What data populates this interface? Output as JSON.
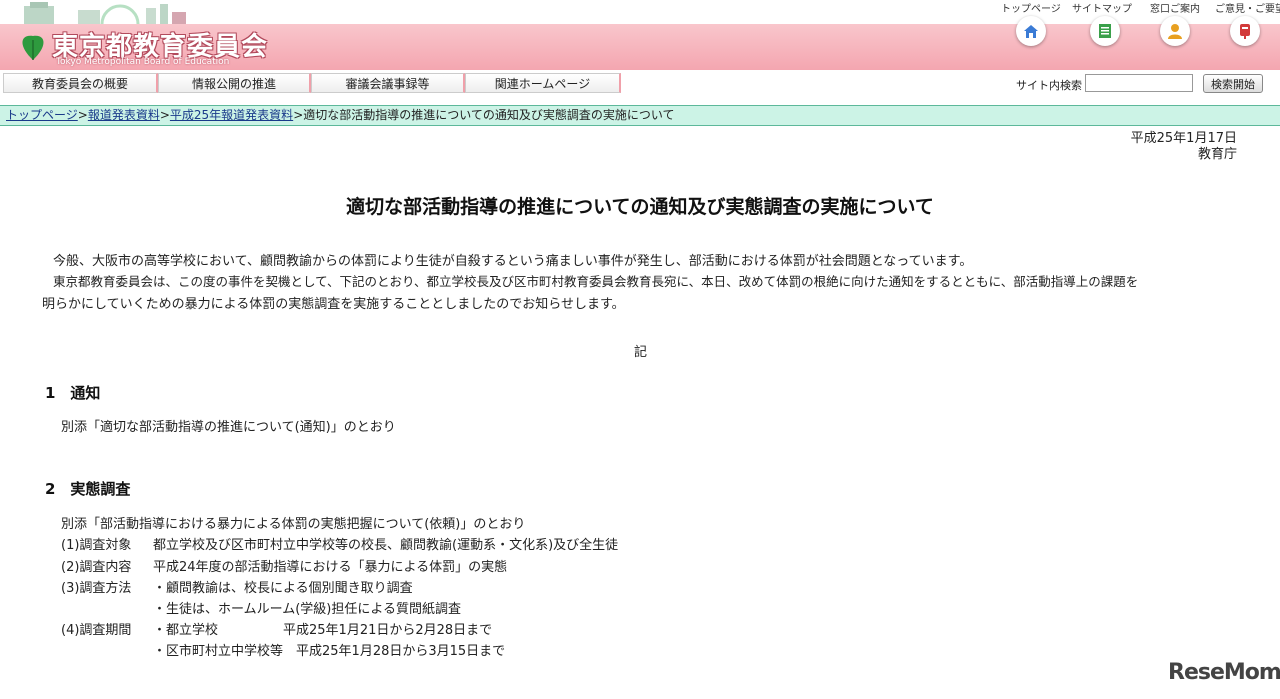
{
  "header": {
    "title": "東京都教育委員会",
    "subtitle": "Tokyo Metropolitan Board of Education",
    "utility_links": [
      {
        "label": "トップページ",
        "icon": "home-icon"
      },
      {
        "label": "サイトマップ",
        "icon": "sitemap-icon"
      },
      {
        "label": "窓口ご案内",
        "icon": "contact-person-icon"
      },
      {
        "label": "ご意見・ご要望",
        "icon": "mailbox-icon"
      }
    ],
    "brand_color": "#f4a6b0"
  },
  "nav": {
    "items": [
      "教育委員会の概要",
      "情報公開の推進",
      "審議会議事録等",
      "関連ホームページ"
    ]
  },
  "search": {
    "label": "サイト内検索",
    "value": "",
    "placeholder": "",
    "button_label": "検索開始"
  },
  "breadcrumb": {
    "links": [
      "トップページ",
      "報道発表資料",
      "平成25年報道発表資料"
    ],
    "separator": ">",
    "current": "適切な部活動指導の推進についての通知及び実態調査の実施について"
  },
  "document": {
    "date": "平成25年1月17日",
    "issuer": "教育庁",
    "title": "適切な部活動指導の推進についての通知及び実態調査の実施について",
    "intro_line1": "今般、大阪市の高等学校において、顧問教諭からの体罰により生徒が自殺するという痛ましい事件が発生し、部活動における体罰が社会問題となっています。",
    "intro_line2": "東京都教育委員会は、この度の事件を契機として、下記のとおり、都立学校長及び区市町村教育委員会教育長宛に、本日、改めて体罰の根絶に向けた通知をするとともに、部活動指導上の課題を",
    "intro_line3": "明らかにしていくための暴力による体罰の実態調査を実施することとしましたのでお知らせします。",
    "ki": "記",
    "section1": {
      "heading": "1　通知",
      "body": "別添「適切な部活動指導の推進について(通知)」のとおり"
    },
    "section2": {
      "heading": "2　実態調査",
      "body": "別添「部活動指導における暴力による体罰の実態把握について(依頼)」のとおり",
      "items": [
        {
          "label": "(1)調査対象",
          "lines": [
            "都立学校及び区市町村立中学校等の校長、顧問教諭(運動系・文化系)及び全生徒"
          ]
        },
        {
          "label": "(2)調査内容",
          "lines": [
            "平成24年度の部活動指導における「暴力による体罰」の実態"
          ]
        },
        {
          "label": "(3)調査方法",
          "lines": [
            "・顧問教諭は、校長による個別聞き取り調査",
            "・生徒は、ホームルーム(学級)担任による質問紙調査"
          ]
        },
        {
          "label": "(4)調査期間",
          "lines": [
            "・都立学校　　　　　平成25年1月21日から2月28日まで",
            "・区市町村立中学校等　平成25年1月28日から3月15日まで"
          ]
        }
      ]
    }
  },
  "watermark": "ReseMom"
}
